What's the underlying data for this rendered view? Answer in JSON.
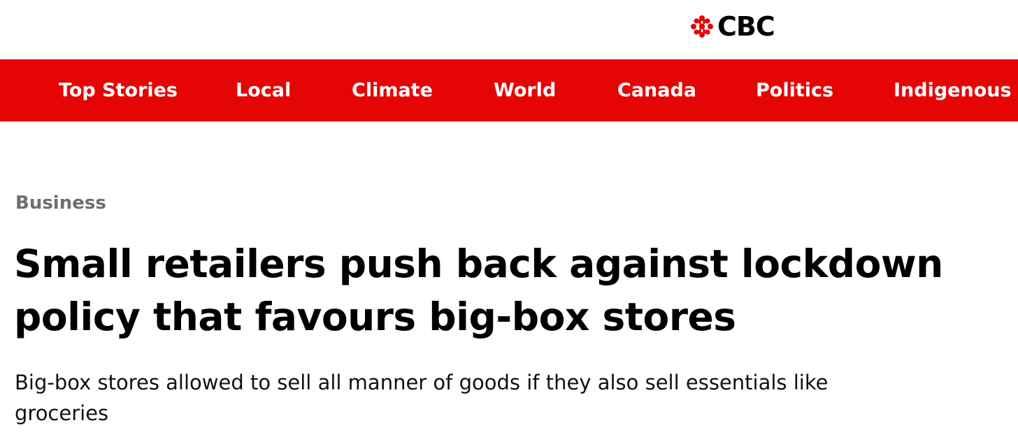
{
  "brand": {
    "logo_text": "CBC",
    "logo_icon": "cbc-gem-icon",
    "brand_color": "#e60505"
  },
  "nav": {
    "items": [
      {
        "label": "Top Stories"
      },
      {
        "label": "Local"
      },
      {
        "label": "Climate"
      },
      {
        "label": "World"
      },
      {
        "label": "Canada"
      },
      {
        "label": "Politics"
      },
      {
        "label": "Indigenous"
      }
    ]
  },
  "article": {
    "section": "Business",
    "headline_line1": "Small retailers push back against lockdown",
    "headline_line2": "policy that favours big-box stores",
    "deck_line1": "Big-box stores allowed to sell all manner of goods if they also sell essentials like",
    "deck_line2": "groceries"
  }
}
